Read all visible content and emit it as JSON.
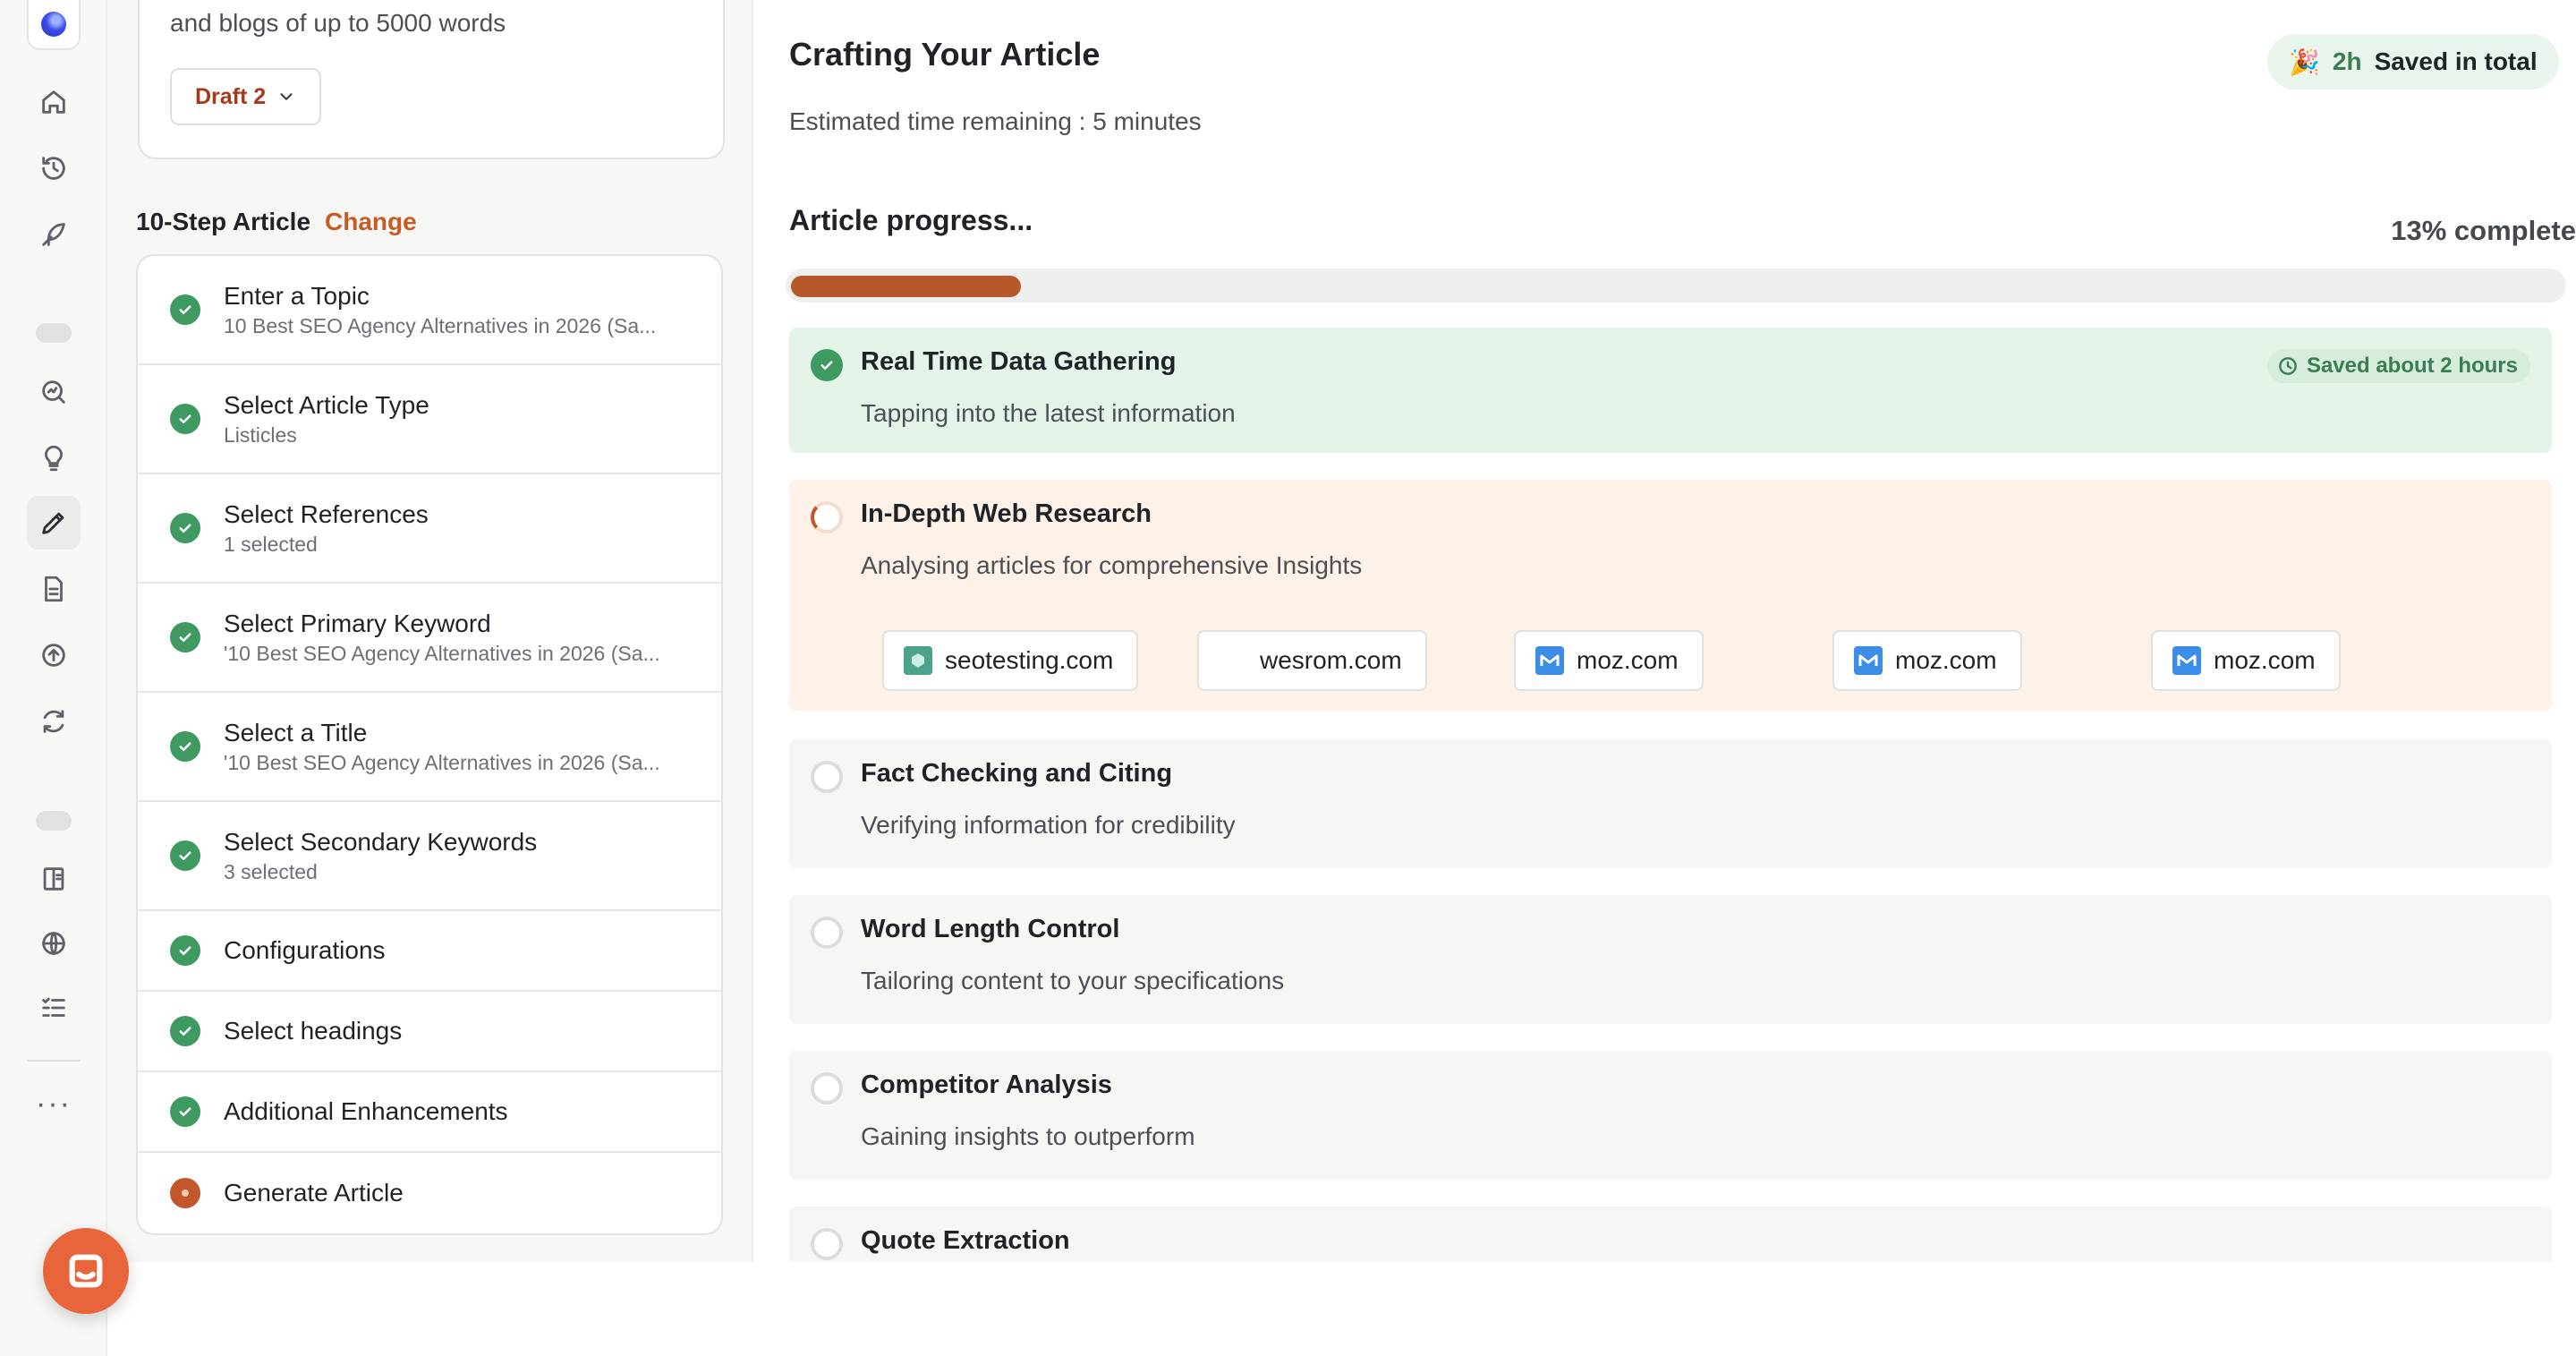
{
  "rail": {
    "icons": [
      "home-icon",
      "history-icon",
      "feather-icon",
      "search-analytics-icon",
      "lightbulb-icon",
      "pencil-icon",
      "document-icon",
      "upload-icon",
      "refresh-icon",
      "book-icon",
      "globe-icon",
      "checklist-icon"
    ],
    "active_icon": "pencil-icon",
    "more_label": "···"
  },
  "left": {
    "intro_text": "and blogs of up to 5000 words",
    "draft_label": "Draft 2",
    "steps_title": "10-Step Article",
    "change_label": "Change",
    "steps": [
      {
        "title": "Enter a Topic",
        "subtitle": "10 Best SEO Agency Alternatives in 2026 (Sa...",
        "status": "done"
      },
      {
        "title": "Select Article Type",
        "subtitle": "Listicles",
        "status": "done"
      },
      {
        "title": "Select References",
        "subtitle": "1 selected",
        "status": "done"
      },
      {
        "title": "Select Primary Keyword",
        "subtitle": "'10 Best SEO Agency Alternatives in 2026 (Sa...",
        "status": "done"
      },
      {
        "title": "Select a Title",
        "subtitle": "'10 Best SEO Agency Alternatives in 2026 (Sa...",
        "status": "done"
      },
      {
        "title": "Select Secondary Keywords",
        "subtitle": "3 selected",
        "status": "done"
      },
      {
        "title": "Configurations",
        "status": "done"
      },
      {
        "title": "Select headings",
        "status": "done"
      },
      {
        "title": "Additional Enhancements",
        "status": "done"
      },
      {
        "title": "Generate Article",
        "status": "current"
      }
    ]
  },
  "main": {
    "title": "Crafting Your Article",
    "eta": "Estimated time remaining : 5 minutes",
    "saved_total_emoji": "🎉",
    "saved_total_hours": "2h",
    "saved_total_label": "Saved in total",
    "progress_label": "Article progress...",
    "progress_text": "13% complete",
    "progress_value": 0.13,
    "stages": [
      {
        "title": "Real Time Data Gathering",
        "subtitle": "Tapping into the latest information",
        "status": "done",
        "badge": "Saved about 2 hours"
      },
      {
        "title": "In-Depth Web Research",
        "subtitle": "Analysing articles for comprehensive Insights",
        "status": "active",
        "sources": [
          {
            "label": "seotesting.com",
            "favicon": "seotesting-icon"
          },
          {
            "label": "wesrom.com",
            "favicon": "blank-icon"
          },
          {
            "label": "moz.com",
            "favicon": "moz-icon"
          },
          {
            "label": "moz.com",
            "favicon": "moz-icon"
          },
          {
            "label": "moz.com",
            "favicon": "moz-icon"
          }
        ]
      },
      {
        "title": "Fact Checking and Citing",
        "subtitle": "Verifying information for credibility",
        "status": "pending"
      },
      {
        "title": "Word Length Control",
        "subtitle": "Tailoring content to your specifications",
        "status": "pending"
      },
      {
        "title": "Competitor Analysis",
        "subtitle": "Gaining insights to outperform",
        "status": "pending"
      },
      {
        "title": "Quote Extraction",
        "status": "pending"
      }
    ]
  },
  "colors": {
    "accent": "#c85a23",
    "progress_fill": "#b7582a",
    "success": "#3f9a62",
    "chat_button": "#e8643a"
  }
}
